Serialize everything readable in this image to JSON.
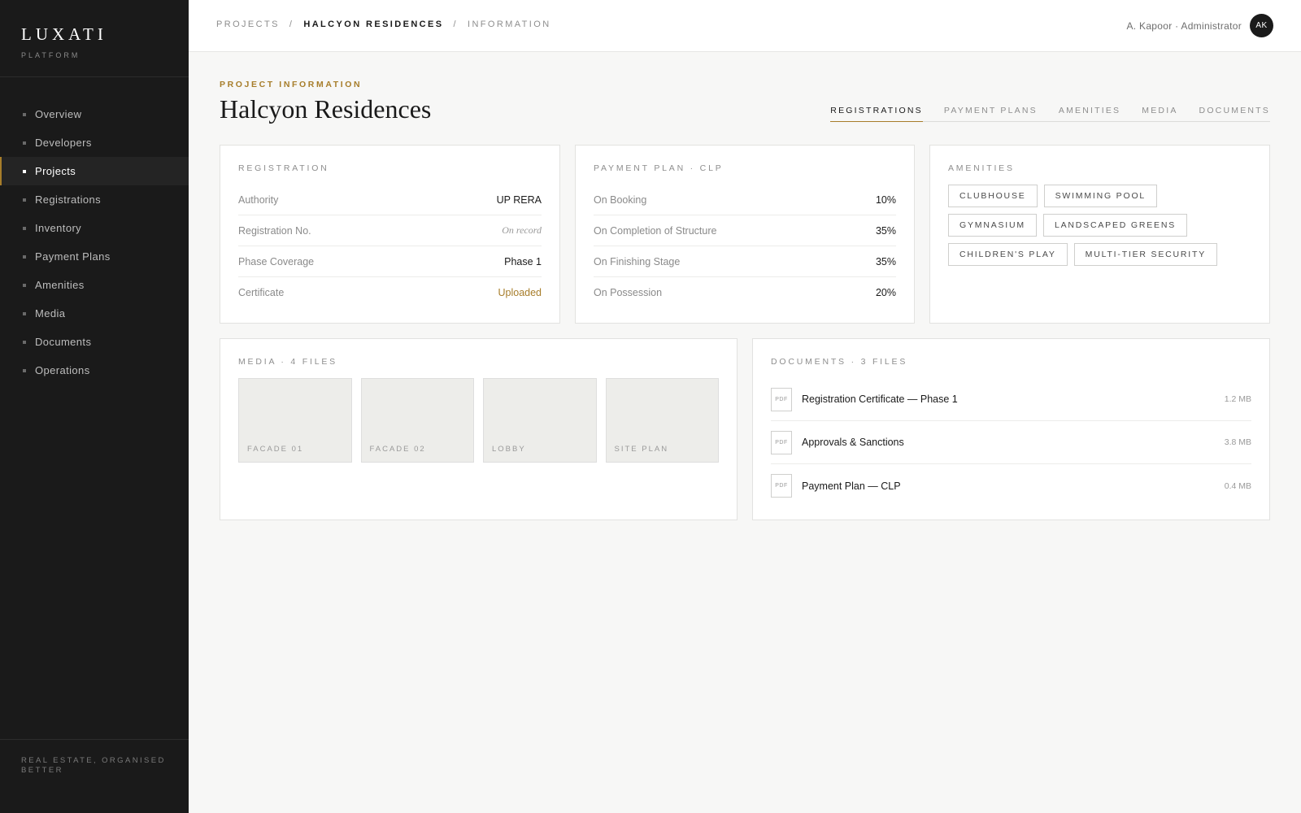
{
  "brand": {
    "name": "LUXATI",
    "subtitle": "PLATFORM",
    "tagline": "REAL ESTATE, ORGANISED BETTER"
  },
  "sidebar": {
    "items": [
      {
        "label": "Overview",
        "active": false
      },
      {
        "label": "Developers",
        "active": false
      },
      {
        "label": "Projects",
        "active": true
      },
      {
        "label": "Registrations",
        "active": false
      },
      {
        "label": "Inventory",
        "active": false
      },
      {
        "label": "Payment Plans",
        "active": false
      },
      {
        "label": "Amenities",
        "active": false
      },
      {
        "label": "Media",
        "active": false
      },
      {
        "label": "Documents",
        "active": false
      },
      {
        "label": "Operations",
        "active": false
      }
    ]
  },
  "header": {
    "breadcrumb": [
      "PROJECTS",
      "HALCYON RESIDENCES",
      "INFORMATION"
    ],
    "separator": "/",
    "user_label": "A. Kapoor · Administrator",
    "avatar_initials": "AK"
  },
  "page": {
    "eyebrow": "PROJECT INFORMATION",
    "title": "Halcyon Residences",
    "tabs": [
      "REGISTRATIONS",
      "PAYMENT PLANS",
      "AMENITIES",
      "MEDIA",
      "DOCUMENTS"
    ],
    "active_tab": "REGISTRATIONS"
  },
  "registration": {
    "label": "REGISTRATION",
    "rows": [
      {
        "key": "Authority",
        "value": "UP RERA"
      },
      {
        "key": "Registration No.",
        "value": "On record"
      },
      {
        "key": "Phase Coverage",
        "value": "Phase 1"
      },
      {
        "key": "Certificate",
        "value": "Uploaded"
      }
    ]
  },
  "payment_plan": {
    "label": "PAYMENT PLAN · CLP",
    "rows": [
      {
        "key": "On Booking",
        "value": "10%"
      },
      {
        "key": "On Completion of Structure",
        "value": "35%"
      },
      {
        "key": "On Finishing Stage",
        "value": "35%"
      },
      {
        "key": "On Possession",
        "value": "20%"
      }
    ]
  },
  "amenities": {
    "label": "AMENITIES",
    "items": [
      "CLUBHOUSE",
      "SWIMMING POOL",
      "GYMNASIUM",
      "LANDSCAPED GREENS",
      "CHILDREN'S PLAY",
      "MULTI-TIER SECURITY"
    ]
  },
  "media": {
    "label": "MEDIA · 4 FILES",
    "items": [
      "FACADE 01",
      "FACADE 02",
      "LOBBY",
      "SITE PLAN"
    ]
  },
  "documents": {
    "label": "DOCUMENTS · 3 FILES",
    "icon_text": "PDF",
    "items": [
      {
        "name": "Registration Certificate — Phase 1",
        "size": "1.2 MB"
      },
      {
        "name": "Approvals & Sanctions",
        "size": "3.8 MB"
      },
      {
        "name": "Payment Plan — CLP",
        "size": "0.4 MB"
      }
    ]
  },
  "colors": {
    "accent": "#a77d2a",
    "sidebar_bg": "#1a1a1a",
    "page_bg": "#f7f7f6"
  }
}
